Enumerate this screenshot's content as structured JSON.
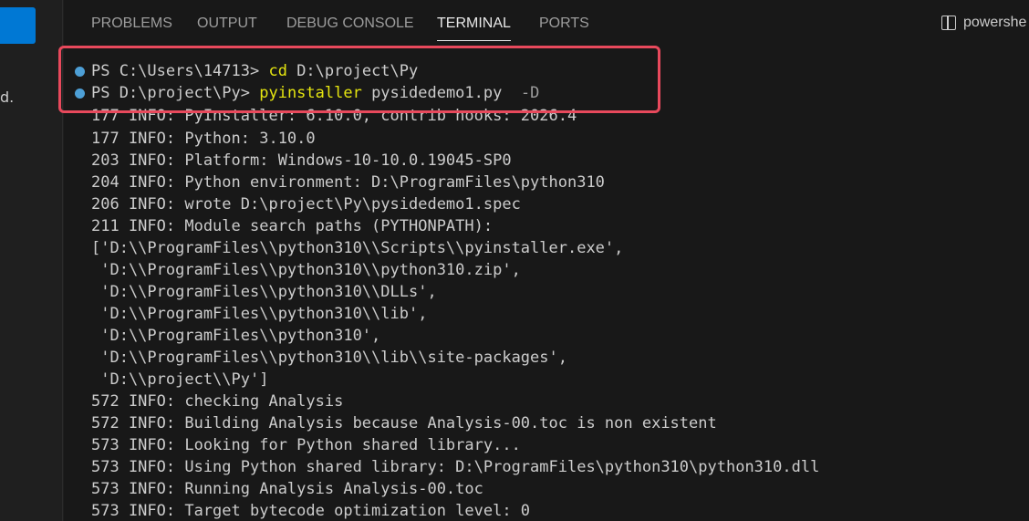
{
  "editor": {
    "left_fragment": "d."
  },
  "panel": {
    "tabs": [
      {
        "label": "PROBLEMS",
        "active": false
      },
      {
        "label": "OUTPUT",
        "active": false
      },
      {
        "label": "DEBUG CONSOLE",
        "active": false
      },
      {
        "label": "TERMINAL",
        "active": true
      },
      {
        "label": "PORTS",
        "active": false
      }
    ],
    "shell_label": "powershe"
  },
  "terminal": {
    "prompt1": {
      "prompt": "PS C:\\Users\\14713> ",
      "command": "cd",
      "args": " D:\\project\\Py"
    },
    "prompt2": {
      "prompt": "PS D:\\project\\Py> ",
      "command": "pyinstaller",
      "args": " pysidedemo1.py ",
      "flag": " -D"
    },
    "partial_line": "177 INFO: PyInstaller: 6.10.0, contrib hooks: 2026.4",
    "lines": [
      "177 INFO: Python: 3.10.0",
      "203 INFO: Platform: Windows-10-10.0.19045-SP0",
      "204 INFO: Python environment: D:\\ProgramFiles\\python310",
      "206 INFO: wrote D:\\project\\Py\\pysidedemo1.spec",
      "211 INFO: Module search paths (PYTHONPATH):",
      "['D:\\\\ProgramFiles\\\\python310\\\\Scripts\\\\pyinstaller.exe',",
      " 'D:\\\\ProgramFiles\\\\python310\\\\python310.zip',",
      " 'D:\\\\ProgramFiles\\\\python310\\\\DLLs',",
      " 'D:\\\\ProgramFiles\\\\python310\\\\lib',",
      " 'D:\\\\ProgramFiles\\\\python310',",
      " 'D:\\\\ProgramFiles\\\\python310\\\\lib\\\\site-packages',",
      " 'D:\\\\project\\\\Py']",
      "572 INFO: checking Analysis",
      "572 INFO: Building Analysis because Analysis-00.toc is non existent",
      "573 INFO: Looking for Python shared library...",
      "573 INFO: Using Python shared library: D:\\ProgramFiles\\python310\\python310.dll",
      "573 INFO: Running Analysis Analysis-00.toc",
      "573 INFO: Target bytecode optimization level: 0"
    ]
  },
  "colors": {
    "accent": "#0078d4",
    "highlight_border": "#e8495c",
    "command_yellow": "#e5e510",
    "prompt_dot": "#4d9fd6"
  }
}
